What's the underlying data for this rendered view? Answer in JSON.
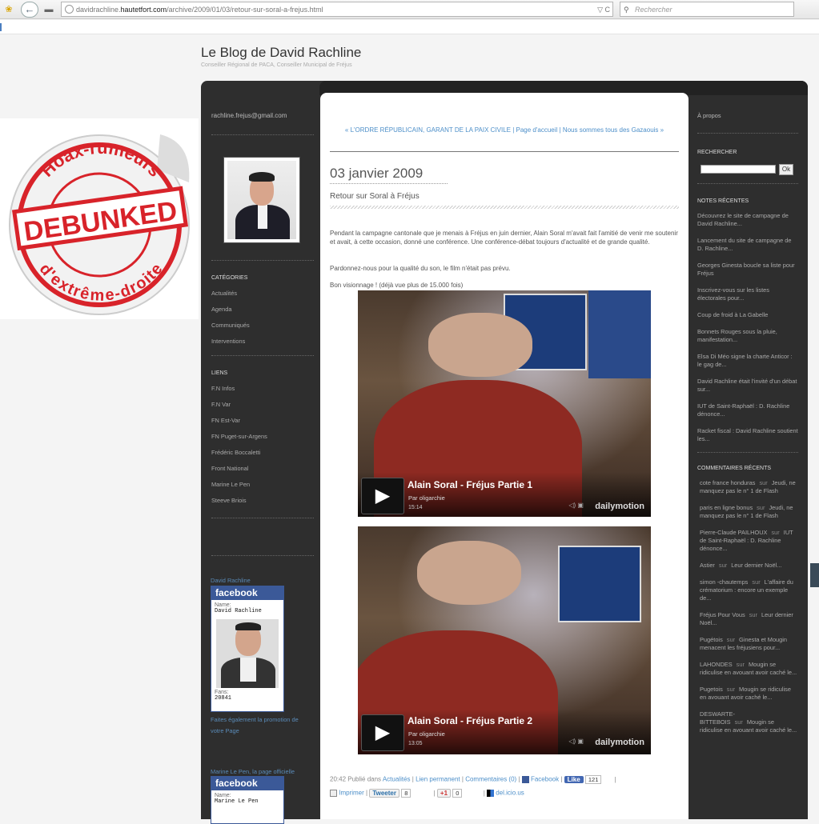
{
  "browser": {
    "url_host": "davidrachline.",
    "url_domain": "hautetfort.com",
    "url_path": "/archive/2009/01/03/retour-sur-soral-a-frejus.html",
    "url_controls": "▽ C",
    "search_placeholder": "Rechercher"
  },
  "blog": {
    "title": "Le Blog de David Rachline",
    "subtitle": "Conseiller Régional de PACA, Conseiller Municipal de Fréjus"
  },
  "left_sidebar": {
    "email": "rachline.frejus@gmail.com",
    "categories_heading": "CATÉGORIES",
    "categories": [
      "Actualités",
      "Agenda",
      "Communiqués",
      "Interventions"
    ],
    "links_heading": "LIENS",
    "links": [
      "F.N Infos",
      "F.N Var",
      "FN Est-Var",
      "FN Puget-sur-Argens",
      "Frédéric Boccaletti",
      "Front National",
      "Marine Le Pen",
      "Steeve Briois"
    ],
    "fb1": {
      "title_link": "David Rachline",
      "brand": "facebook",
      "name_label": "Name:",
      "name": "David Rachline",
      "fans_label": "Fans:",
      "fans": "20841",
      "promo": "Faites également la promotion de votre Page"
    },
    "fb2": {
      "title_link": "Marine Le Pen, la page officielle",
      "brand": "facebook",
      "name_label": "Name:",
      "name": "Marine Le Pen"
    }
  },
  "overlay": {
    "top_text": "Hoax-rumeurs",
    "stamp": "DEBUNKED",
    "bottom_text": "d'extrême-droite",
    "color": "#d8232a"
  },
  "post": {
    "nav_text": "« L'ORDRE RÉPUBLICAIN, GARANT DE LA PAIX CIVILE | Page d'accueil | Nous sommes tous des Gazaouis »",
    "date": "03 janvier 2009",
    "title": "Retour sur Soral à Fréjus",
    "para1": "Pendant la campagne cantonale que je menais à Fréjus en juin dernier, Alain Soral m'avait fait l'amitié de venir me soutenir et avait, à cette occasion, donné une conférence. Une conférence-débat toujours d'actualité et de grande qualité.",
    "para2": "Pardonnez-nous pour la qualité du son, le film n'était pas prévu.",
    "para3": "Bon visionnage ! (déjà vue plus de 15.000 fois)",
    "videos": [
      {
        "title": "Alain Soral - Fréjus Partie 1",
        "by": "Par oligarchie",
        "duration": "15:14",
        "brand": "dailymotion"
      },
      {
        "title": "Alain Soral - Fréjus Partie 2",
        "by": "Par oligarchie",
        "duration": "13:05",
        "brand": "dailymotion"
      }
    ],
    "footer": {
      "time_published": "20:42 Publié dans",
      "category": "Actualités",
      "permalink": "Lien permanent",
      "comments": "Commentaires (0)",
      "facebook": "Facebook",
      "like": "Like",
      "like_count": "121",
      "print": "Imprimer",
      "tweet": "Tweeter",
      "tweet_count": "8",
      "gplus": "+1",
      "gplus_count": "0",
      "delicious": "del.icio.us"
    }
  },
  "right_sidebar": {
    "about": "À propos",
    "search_heading": "RECHERCHER",
    "search_button": "Ok",
    "notes_heading": "NOTES RÉCENTES",
    "notes": [
      "Découvrez le site de campagne de David Rachline...",
      "Lancement du site de campagne de D. Rachline...",
      "Georges Ginesta boucle sa liste pour Fréjus",
      "Inscrivez-vous sur les listes électorales pour...",
      "Coup de froid à La Gabelle",
      "Bonnets Rouges sous la pluie, manifestation...",
      "Elsa Di Méo signe la charte Anticor : le gag de...",
      "David Rachline était l'invité d'un débat sur...",
      "IUT de Saint-Raphaël : D. Rachline dénonce...",
      "Racket fiscal : David Rachline soutient les..."
    ],
    "comments_heading": "COMMENTAIRES RÉCENTS",
    "comments": [
      {
        "author": "cote france honduras",
        "sur": "sur",
        "post": "Jeudi, ne manquez pas le n° 1 de Flash"
      },
      {
        "author": "paris en ligne bonus",
        "sur": "sur",
        "post": "Jeudi, ne manquez pas le n° 1 de Flash"
      },
      {
        "author": "Pierre-Claude PAILHOUX",
        "sur": "sur",
        "post": "IUT de Saint-Raphaël : D. Rachline dénonce..."
      },
      {
        "author": "Astier",
        "sur": "sur",
        "post": "Leur dernier Noël..."
      },
      {
        "author": "simon -chautemps",
        "sur": "sur",
        "post": "L'affaire du crématorium : encore un exemple de..."
      },
      {
        "author": "Fréjus Pour Vous",
        "sur": "sur",
        "post": "Leur dernier Noël..."
      },
      {
        "author": "Pugétois",
        "sur": "sur",
        "post": "Ginesta et Mougin menacent les fréjusiens pour..."
      },
      {
        "author": "LAHONDES",
        "sur": "sur",
        "post": "Mougin se ridiculise en avouant avoir caché le..."
      },
      {
        "author": "Pugetois",
        "sur": "sur",
        "post": "Mougin se ridiculise en avouant avoir caché le..."
      },
      {
        "author": "DESWARTE-BITTEBOIS",
        "sur": "sur",
        "post": "Mougin se ridiculise en avouant avoir caché le..."
      }
    ]
  }
}
